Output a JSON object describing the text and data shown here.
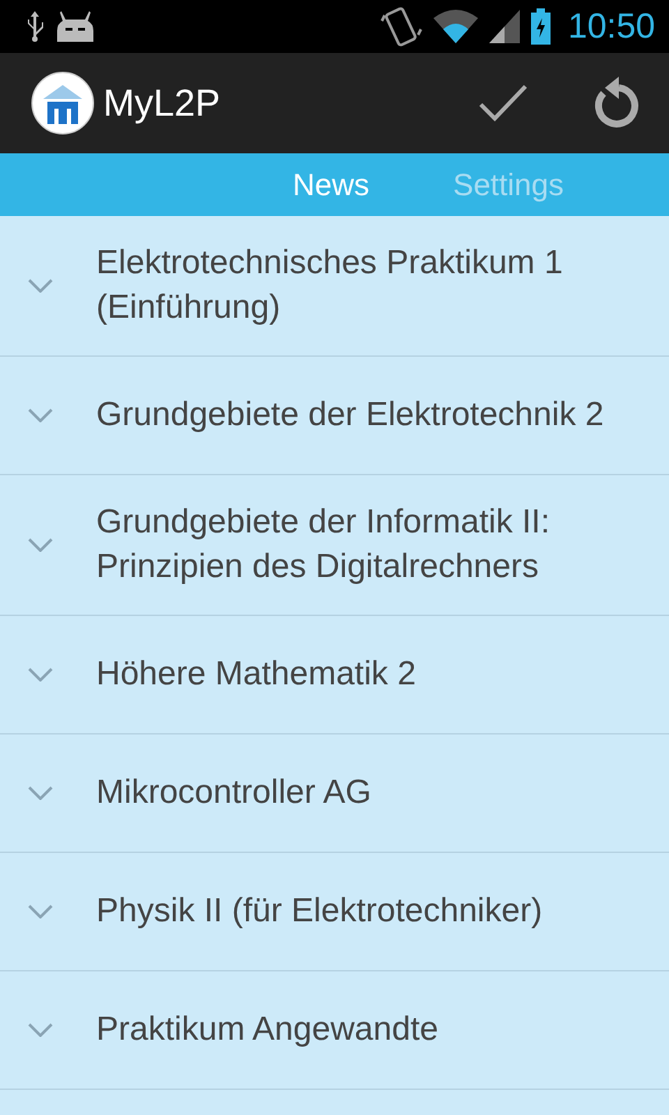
{
  "status_bar": {
    "time": "10:50"
  },
  "action_bar": {
    "title": "MyL2P"
  },
  "tabs": [
    {
      "label": "News",
      "selected": true
    },
    {
      "label": "Settings",
      "selected": false
    }
  ],
  "courses": [
    {
      "title": "Elektrotechnisches Praktikum 1 (Einführung)",
      "expanded": false
    },
    {
      "title": "Grundgebiete der Elektrotechnik 2",
      "expanded": false
    },
    {
      "title": "Grundgebiete der Informatik II: Prinzipien des Digitalrechners",
      "expanded": false
    },
    {
      "title": "Höhere Mathematik 2",
      "expanded": false
    },
    {
      "title": "Mikrocontroller AG",
      "expanded": false
    },
    {
      "title": "Physik II (für Elektrotechniker)",
      "expanded": false
    },
    {
      "title": "Praktikum Angewandte",
      "expanded": false
    }
  ]
}
